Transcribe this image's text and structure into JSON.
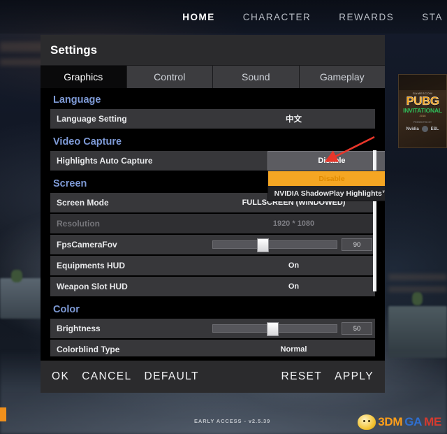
{
  "topnav": {
    "items": [
      {
        "label": "HOME",
        "active": true
      },
      {
        "label": "CHARACTER",
        "active": false
      },
      {
        "label": "REWARDS",
        "active": false
      },
      {
        "label": "STA",
        "active": false
      }
    ]
  },
  "banner": {
    "kicker": "GAMESCOM",
    "title": "PUBG",
    "subtitle": "INVITATIONAL",
    "year": "2018",
    "presented_by": "PRESENTED BY",
    "logo_left": "Nvidia",
    "logo_right": "ESL"
  },
  "panel": {
    "title": "Settings",
    "tabs": [
      {
        "label": "Graphics",
        "active": true
      },
      {
        "label": "Control",
        "active": false
      },
      {
        "label": "Sound",
        "active": false
      },
      {
        "label": "Gameplay",
        "active": false
      }
    ],
    "groups": [
      {
        "heading": "Language",
        "rows": [
          {
            "label": "Language Setting",
            "value": "中文",
            "kind": "value",
            "cjk": true
          }
        ]
      },
      {
        "heading": "Video Capture",
        "rows": [
          {
            "label": "Highlights Auto Capture",
            "value": "Disable",
            "kind": "select-open",
            "options": [
              {
                "label": "Disable",
                "selected": true
              },
              {
                "label": "NVIDIA ShadowPlay Highlights™",
                "selected": false
              }
            ]
          }
        ]
      },
      {
        "heading": "Screen",
        "rows": [
          {
            "label": "Screen Mode",
            "value": "FULLSCREEN (WINDOWED)",
            "kind": "value"
          },
          {
            "label": "Resolution",
            "value": "1920 * 1080",
            "kind": "value",
            "disabled": true
          },
          {
            "label": "FpsCameraFov",
            "value": "90",
            "kind": "slider",
            "percent": 40
          },
          {
            "label": "Equipments HUD",
            "value": "On",
            "kind": "value"
          },
          {
            "label": "Weapon Slot HUD",
            "value": "On",
            "kind": "value"
          }
        ]
      },
      {
        "heading": "Color",
        "rows": [
          {
            "label": "Brightness",
            "value": "50",
            "kind": "slider",
            "percent": 48
          },
          {
            "label": "Colorblind Type",
            "value": "Normal",
            "kind": "value"
          }
        ]
      }
    ],
    "footer": {
      "left_buttons": [
        "OK",
        "CANCEL",
        "DEFAULT"
      ],
      "right_buttons": [
        "RESET",
        "APPLY"
      ]
    }
  },
  "status": {
    "early_access": "EARLY ACCESS - v2.5.39"
  },
  "watermark": {
    "part1": "3DM",
    "part2": "GA",
    "part3": "ME"
  },
  "colors": {
    "accent_orange": "#f5a623",
    "group_heading_blue": "#7e9ad6",
    "panel_header": "#2b2b2d",
    "row_bg": "#37373a",
    "annotation_red": "#e8362a"
  }
}
